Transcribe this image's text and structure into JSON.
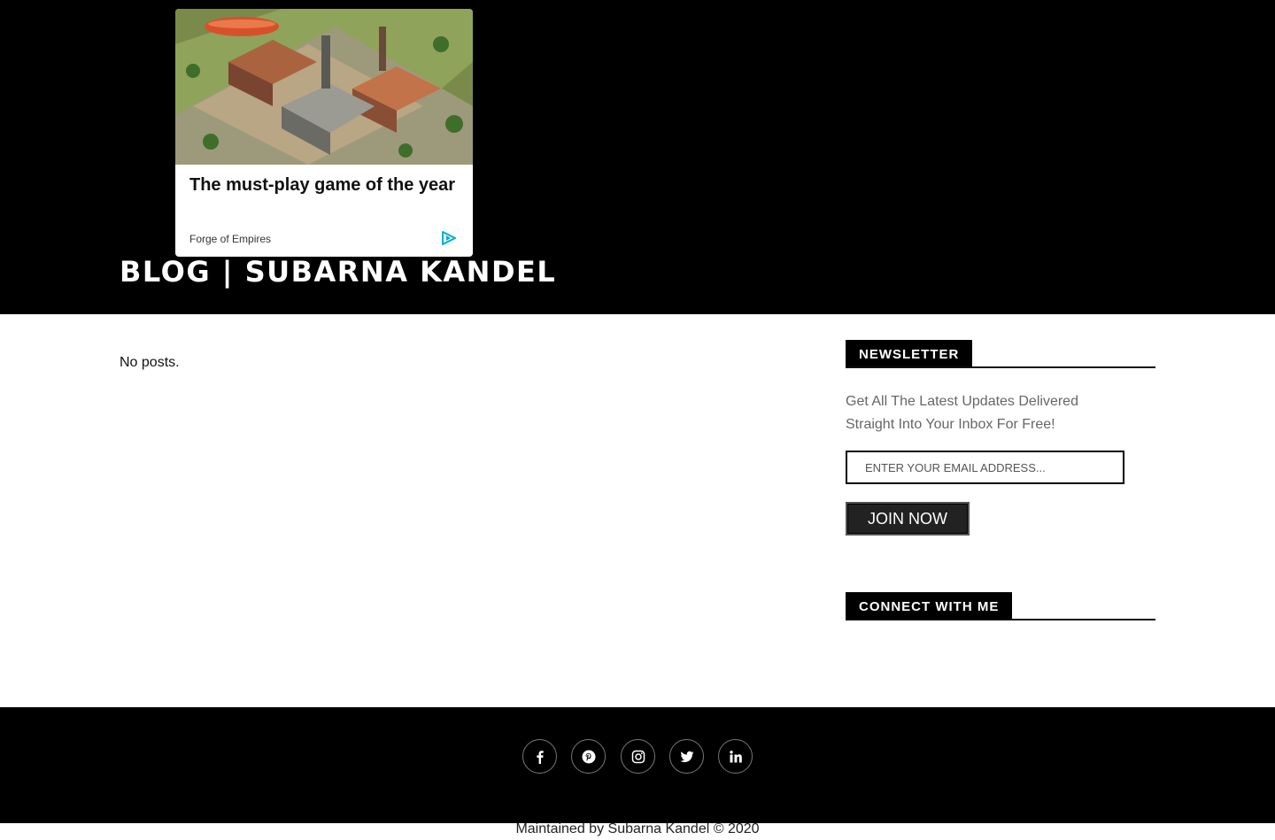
{
  "header": {
    "site_title": "BLOG | SUBARNA KANDEL",
    "ad": {
      "headline": "The must-play game of the year",
      "source": "Forge of Empires",
      "icon": "ad-choices-icon",
      "image": "city-builder-game-scene"
    }
  },
  "main": {
    "empty_message": "No posts."
  },
  "sidebar": {
    "newsletter": {
      "title": "NEWSLETTER",
      "description": "Get All The Latest Updates Delivered Straight Into Your Inbox For Free!",
      "email_placeholder": "ENTER YOUR EMAIL ADDRESS...",
      "button_label": "JOIN NOW"
    },
    "connect": {
      "title": "CONNECT WITH ME"
    }
  },
  "footer": {
    "social": [
      "facebook-icon",
      "pinterest-icon",
      "instagram-icon",
      "twitter-icon",
      "linkedin-icon"
    ],
    "copyright": "Maintained by Subarna Kandel © 2020"
  },
  "colors": {
    "header_bg": "#000000",
    "footer_bg": "#000000",
    "ad_icon": "#00aecd"
  }
}
